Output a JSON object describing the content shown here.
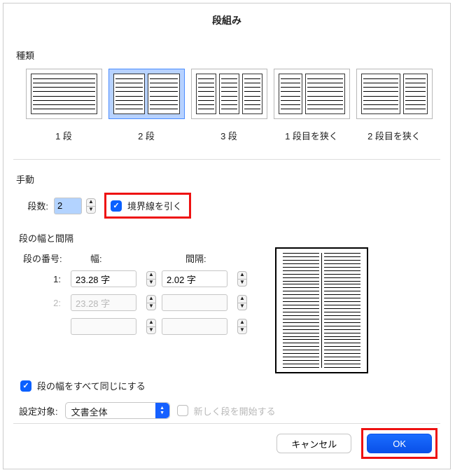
{
  "title": "段組み",
  "sections": {
    "presets_label": "種類",
    "manual_label": "手動",
    "width_spacing_label": "段の幅と間隔"
  },
  "presets": [
    {
      "label": "1 段"
    },
    {
      "label": "2 段"
    },
    {
      "label": "3 段"
    },
    {
      "label": "1 段目を狭く"
    },
    {
      "label": "2 段目を狭く"
    }
  ],
  "manual": {
    "count_label": "段数:",
    "count_value": "2",
    "line_between_label": "境界線を引く"
  },
  "width_table": {
    "col_num_label": "段の番号:",
    "width_label": "幅:",
    "spacing_label": "間隔:",
    "rows": [
      {
        "num": "1:",
        "width": "23.28 字",
        "spacing": "2.02 字",
        "enabled": true
      },
      {
        "num": "2:",
        "width": "23.28 字",
        "spacing": "",
        "enabled": false
      },
      {
        "num": "",
        "width": "",
        "spacing": "",
        "enabled": false
      }
    ]
  },
  "equal_width_label": "段の幅をすべて同じにする",
  "apply": {
    "label": "設定対象:",
    "value": "文書全体",
    "start_new_label": "新しく段を開始する"
  },
  "buttons": {
    "cancel": "キャンセル",
    "ok": "OK"
  }
}
